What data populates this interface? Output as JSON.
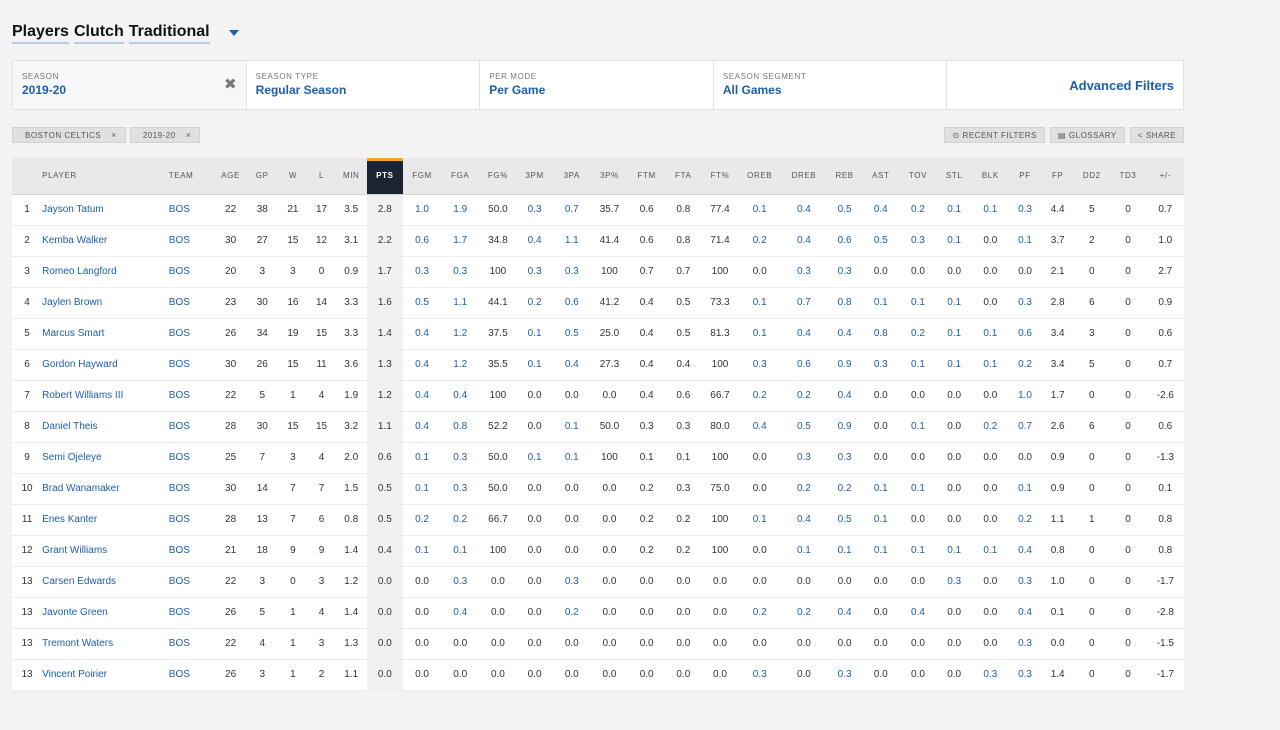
{
  "title": {
    "words": [
      "Players",
      "Clutch",
      "Traditional"
    ]
  },
  "filters": [
    {
      "label": "SEASON",
      "value": "2019-20",
      "clearable": true
    },
    {
      "label": "SEASON TYPE",
      "value": "Regular Season"
    },
    {
      "label": "PER MODE",
      "value": "Per Game"
    },
    {
      "label": "SEASON SEGMENT",
      "value": "All Games"
    }
  ],
  "advanced_filters_label": "Advanced Filters",
  "chips": [
    {
      "label": "BOSTON CELTICS",
      "remove": "×"
    },
    {
      "label": "2019-20",
      "remove": "×"
    }
  ],
  "actions": [
    {
      "label": "RECENT FILTERS",
      "icon": "⊙"
    },
    {
      "label": "GLOSSARY",
      "icon": "▤"
    },
    {
      "label": "SHARE",
      "icon": "<"
    }
  ],
  "columns": [
    "",
    "PLAYER",
    "TEAM",
    "AGE",
    "GP",
    "W",
    "L",
    "MIN",
    "PTS",
    "FGM",
    "FGA",
    "FG%",
    "3PM",
    "3PA",
    "3P%",
    "FTM",
    "FTA",
    "FT%",
    "OREB",
    "DREB",
    "REB",
    "AST",
    "TOV",
    "STL",
    "BLK",
    "PF",
    "FP",
    "DD2",
    "TD3",
    "+/-"
  ],
  "sorted_column": "PTS",
  "link_color": "#1d5ea8",
  "rows": [
    [
      "1",
      "Jayson Tatum",
      "BOS",
      "22",
      "38",
      "21",
      "17",
      "3.5",
      "2.8",
      "1.0",
      "1.9",
      "50.0",
      "0.3",
      "0.7",
      "35.7",
      "0.6",
      "0.8",
      "77.4",
      "0.1",
      "0.4",
      "0.5",
      "0.4",
      "0.2",
      "0.1",
      "0.1",
      "0.3",
      "4.4",
      "5",
      "0",
      "0.7"
    ],
    [
      "2",
      "Kemba Walker",
      "BOS",
      "30",
      "27",
      "15",
      "12",
      "3.1",
      "2.2",
      "0.6",
      "1.7",
      "34.8",
      "0.4",
      "1.1",
      "41.4",
      "0.6",
      "0.8",
      "71.4",
      "0.2",
      "0.4",
      "0.6",
      "0.5",
      "0.3",
      "0.1",
      "0.0",
      "0.1",
      "3.7",
      "2",
      "0",
      "1.0"
    ],
    [
      "3",
      "Romeo Langford",
      "BOS",
      "20",
      "3",
      "3",
      "0",
      "0.9",
      "1.7",
      "0.3",
      "0.3",
      "100",
      "0.3",
      "0.3",
      "100",
      "0.7",
      "0.7",
      "100",
      "0.0",
      "0.3",
      "0.3",
      "0.0",
      "0.0",
      "0.0",
      "0.0",
      "0.0",
      "2.1",
      "0",
      "0",
      "2.7"
    ],
    [
      "4",
      "Jaylen Brown",
      "BOS",
      "23",
      "30",
      "16",
      "14",
      "3.3",
      "1.6",
      "0.5",
      "1.1",
      "44.1",
      "0.2",
      "0.6",
      "41.2",
      "0.4",
      "0.5",
      "73.3",
      "0.1",
      "0.7",
      "0.8",
      "0.1",
      "0.1",
      "0.1",
      "0.0",
      "0.3",
      "2.8",
      "6",
      "0",
      "0.9"
    ],
    [
      "5",
      "Marcus Smart",
      "BOS",
      "26",
      "34",
      "19",
      "15",
      "3.3",
      "1.4",
      "0.4",
      "1.2",
      "37.5",
      "0.1",
      "0.5",
      "25.0",
      "0.4",
      "0.5",
      "81.3",
      "0.1",
      "0.4",
      "0.4",
      "0.8",
      "0.2",
      "0.1",
      "0.1",
      "0.6",
      "3.4",
      "3",
      "0",
      "0.6"
    ],
    [
      "6",
      "Gordon Hayward",
      "BOS",
      "30",
      "26",
      "15",
      "11",
      "3.6",
      "1.3",
      "0.4",
      "1.2",
      "35.5",
      "0.1",
      "0.4",
      "27.3",
      "0.4",
      "0.4",
      "100",
      "0.3",
      "0.6",
      "0.9",
      "0.3",
      "0.1",
      "0.1",
      "0.1",
      "0.2",
      "3.4",
      "5",
      "0",
      "0.7"
    ],
    [
      "7",
      "Robert Williams III",
      "BOS",
      "22",
      "5",
      "1",
      "4",
      "1.9",
      "1.2",
      "0.4",
      "0.4",
      "100",
      "0.0",
      "0.0",
      "0.0",
      "0.4",
      "0.6",
      "66.7",
      "0.2",
      "0.2",
      "0.4",
      "0.0",
      "0.0",
      "0.0",
      "0.0",
      "1.0",
      "1.7",
      "0",
      "0",
      "-2.6"
    ],
    [
      "8",
      "Daniel Theis",
      "BOS",
      "28",
      "30",
      "15",
      "15",
      "3.2",
      "1.1",
      "0.4",
      "0.8",
      "52.2",
      "0.0",
      "0.1",
      "50.0",
      "0.3",
      "0.3",
      "80.0",
      "0.4",
      "0.5",
      "0.9",
      "0.0",
      "0.1",
      "0.0",
      "0.2",
      "0.7",
      "2.6",
      "6",
      "0",
      "0.6"
    ],
    [
      "9",
      "Semi Ojeleye",
      "BOS",
      "25",
      "7",
      "3",
      "4",
      "2.0",
      "0.6",
      "0.1",
      "0.3",
      "50.0",
      "0.1",
      "0.1",
      "100",
      "0.1",
      "0.1",
      "100",
      "0.0",
      "0.3",
      "0.3",
      "0.0",
      "0.0",
      "0.0",
      "0.0",
      "0.0",
      "0.9",
      "0",
      "0",
      "-1.3"
    ],
    [
      "10",
      "Brad Wanamaker",
      "BOS",
      "30",
      "14",
      "7",
      "7",
      "1.5",
      "0.5",
      "0.1",
      "0.3",
      "50.0",
      "0.0",
      "0.0",
      "0.0",
      "0.2",
      "0.3",
      "75.0",
      "0.0",
      "0.2",
      "0.2",
      "0.1",
      "0.1",
      "0.0",
      "0.0",
      "0.1",
      "0.9",
      "0",
      "0",
      "0.1"
    ],
    [
      "11",
      "Enes Kanter",
      "BOS",
      "28",
      "13",
      "7",
      "6",
      "0.8",
      "0.5",
      "0.2",
      "0.2",
      "66.7",
      "0.0",
      "0.0",
      "0.0",
      "0.2",
      "0.2",
      "100",
      "0.1",
      "0.4",
      "0.5",
      "0.1",
      "0.0",
      "0.0",
      "0.0",
      "0.2",
      "1.1",
      "1",
      "0",
      "0.8"
    ],
    [
      "12",
      "Grant Williams",
      "BOS",
      "21",
      "18",
      "9",
      "9",
      "1.4",
      "0.4",
      "0.1",
      "0.1",
      "100",
      "0.0",
      "0.0",
      "0.0",
      "0.2",
      "0.2",
      "100",
      "0.0",
      "0.1",
      "0.1",
      "0.1",
      "0.1",
      "0.1",
      "0.1",
      "0.4",
      "0.8",
      "0",
      "0",
      "0.8"
    ],
    [
      "13",
      "Carsen Edwards",
      "BOS",
      "22",
      "3",
      "0",
      "3",
      "1.2",
      "0.0",
      "0.0",
      "0.3",
      "0.0",
      "0.0",
      "0.3",
      "0.0",
      "0.0",
      "0.0",
      "0.0",
      "0.0",
      "0.0",
      "0.0",
      "0.0",
      "0.0",
      "0.3",
      "0.0",
      "0.3",
      "1.0",
      "0",
      "0",
      "-1.7"
    ],
    [
      "13",
      "Javonte Green",
      "BOS",
      "26",
      "5",
      "1",
      "4",
      "1.4",
      "0.0",
      "0.0",
      "0.4",
      "0.0",
      "0.0",
      "0.2",
      "0.0",
      "0.0",
      "0.0",
      "0.0",
      "0.2",
      "0.2",
      "0.4",
      "0.0",
      "0.4",
      "0.0",
      "0.0",
      "0.4",
      "0.1",
      "0",
      "0",
      "-2.8"
    ],
    [
      "13",
      "Tremont Waters",
      "BOS",
      "22",
      "4",
      "1",
      "3",
      "1.3",
      "0.0",
      "0.0",
      "0.0",
      "0.0",
      "0.0",
      "0.0",
      "0.0",
      "0.0",
      "0.0",
      "0.0",
      "0.0",
      "0.0",
      "0.0",
      "0.0",
      "0.0",
      "0.0",
      "0.0",
      "0.3",
      "0.0",
      "0",
      "0",
      "-1.5"
    ],
    [
      "13",
      "Vincent Poirier",
      "BOS",
      "26",
      "3",
      "1",
      "2",
      "1.1",
      "0.0",
      "0.0",
      "0.0",
      "0.0",
      "0.0",
      "0.0",
      "0.0",
      "0.0",
      "0.0",
      "0.0",
      "0.3",
      "0.0",
      "0.3",
      "0.0",
      "0.0",
      "0.0",
      "0.3",
      "0.3",
      "1.4",
      "0",
      "0",
      "-1.7"
    ]
  ]
}
